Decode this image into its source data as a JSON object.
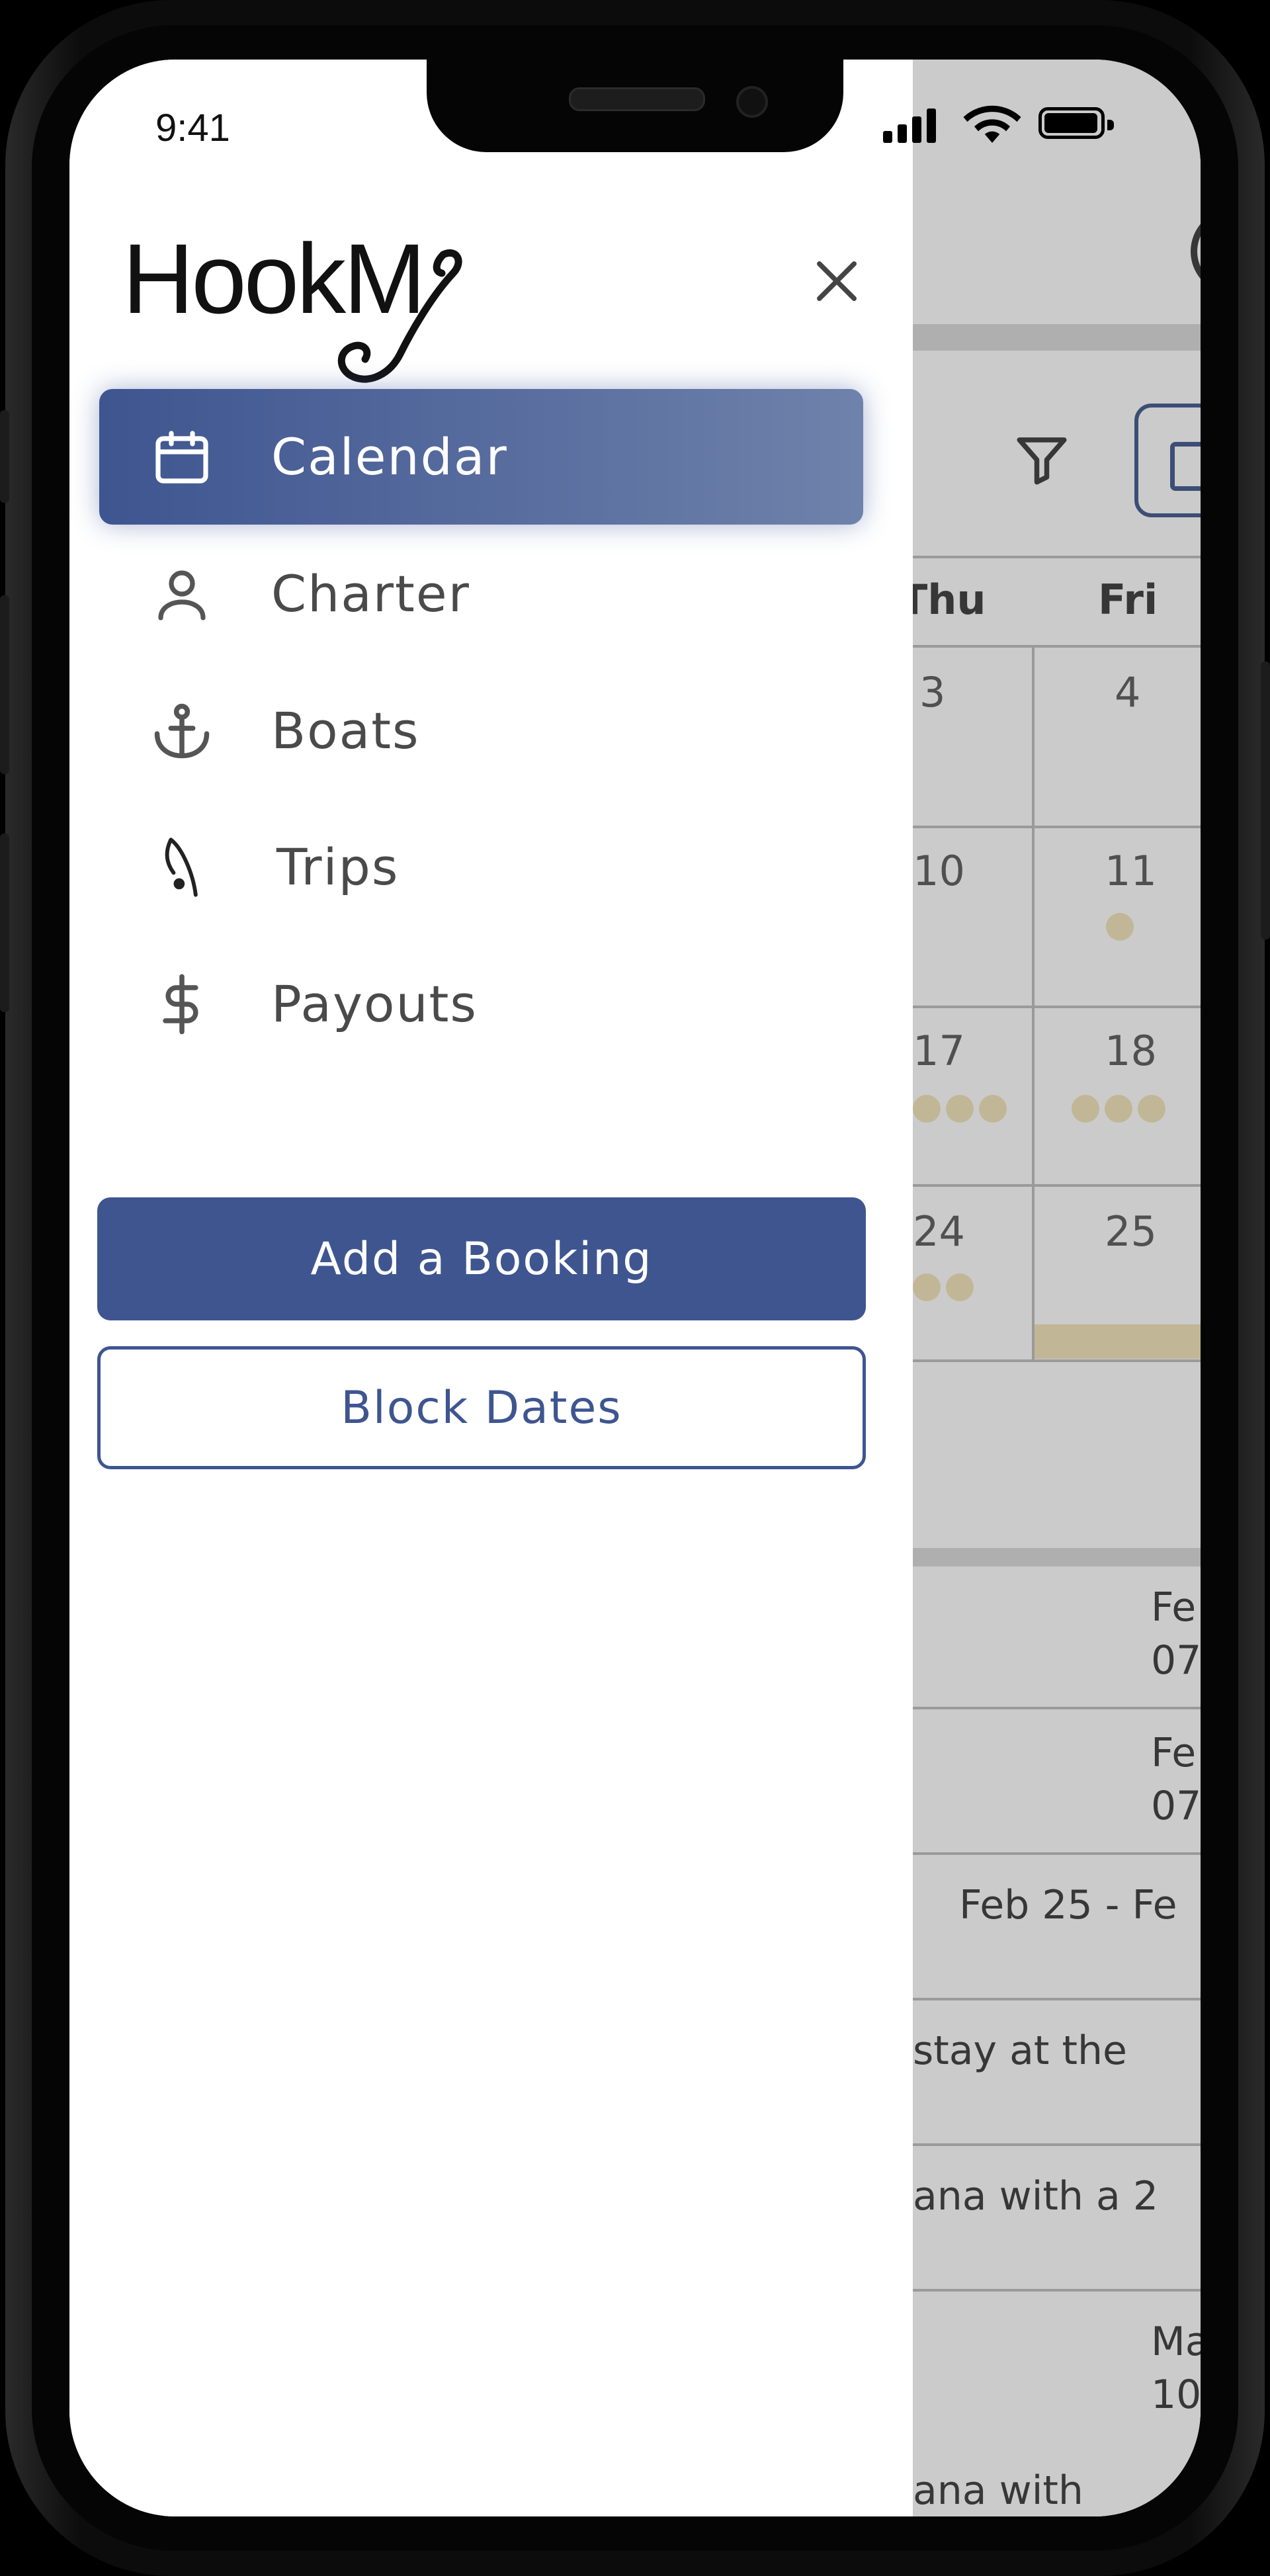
{
  "status_bar": {
    "time": "9:41"
  },
  "drawer": {
    "logo_text": "HookM",
    "nav": [
      {
        "label": "Calendar",
        "icon": "calendar-icon",
        "active": true
      },
      {
        "label": "Charter",
        "icon": "person-icon",
        "active": false
      },
      {
        "label": "Boats",
        "icon": "anchor-icon",
        "active": false
      },
      {
        "label": "Trips",
        "icon": "fishing-rod-icon",
        "active": false
      },
      {
        "label": "Payouts",
        "icon": "dollar-icon",
        "active": false
      }
    ],
    "add_booking_label": "Add a Booking",
    "block_dates_label": "Block Dates"
  },
  "background": {
    "days": [
      "Thu",
      "Fri"
    ],
    "numbers": [
      "3",
      "4",
      "10",
      "11",
      "17",
      "18",
      "24",
      "25"
    ],
    "list": [
      "Fe",
      "07",
      "Fe",
      "07",
      "Feb 25 - Fe",
      "stay at the",
      "ana with a 2",
      "Ma",
      "10",
      "ana with"
    ]
  },
  "colors": {
    "accent": "#3e5590",
    "accent_light": "#6f82ab",
    "text": "#4a4a4a"
  }
}
